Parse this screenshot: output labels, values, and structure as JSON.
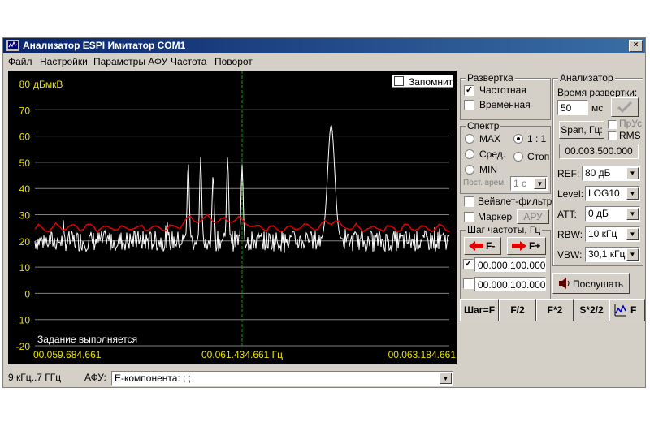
{
  "window": {
    "title": "Анализатор ESPI Имитатор COM1",
    "close": "×"
  },
  "menu": [
    "Файл",
    "Настройки",
    "Параметры АФУ",
    "Частота",
    "Поворот"
  ],
  "plot": {
    "unit": "дБмкВ",
    "y_ticks": [
      "80",
      "70",
      "60",
      "50",
      "40",
      "30",
      "20",
      "10",
      "0",
      "-10",
      "-20"
    ],
    "x_ticks": [
      "00.059.684.661",
      "00.061.434.661 Гц",
      "00.063.184.661"
    ],
    "status_text": "Задание выполняется",
    "memorize_label": "Запомнить",
    "colors": {
      "background": "#000000",
      "trace": "#ffffff",
      "average": "#e00000",
      "marker": "#00a000",
      "labels": "#e8e000",
      "grid": "#808080"
    }
  },
  "chart_data": {
    "type": "line",
    "ylabel": "дБмкВ",
    "ylim": [
      -20,
      80
    ],
    "xlim": [
      "00.059.684.661",
      "00.063.184.661"
    ],
    "peaks": [
      {
        "x": 0.37,
        "level": 50
      },
      {
        "x": 0.4,
        "level": 52
      },
      {
        "x": 0.43,
        "level": 45
      },
      {
        "x": 0.465,
        "level": 52
      },
      {
        "x": 0.5,
        "level": 49
      },
      {
        "x": 0.715,
        "level": 64
      }
    ],
    "noise_level": 20,
    "average_level": 25,
    "marker_x": 0.5
  },
  "status": {
    "range": "9 кГц..7 ГГц",
    "afu_label": "АФУ:",
    "afu_value": "E-компонента: ; ;"
  },
  "sweep": {
    "title": "Развертка",
    "freq": "Частотная",
    "freq_checked": true,
    "time": "Временная",
    "time_checked": false
  },
  "spectrum": {
    "title": "Спектр",
    "max": "MAX",
    "ratio": "1 : 1",
    "avg": "Сред.",
    "stop": "Стоп",
    "min": "MIN",
    "const_label": "Пост. врем.",
    "const_value": "1 с"
  },
  "wavelet": "Вейвлет-фильтр",
  "marker": {
    "label": "Маркер",
    "afu_btn": "АРУ"
  },
  "step": {
    "title": "Шаг частоты, Гц",
    "fminus": "F-",
    "fplus": "F+",
    "val1": "00.000.100.000",
    "val2": "00.000.100.000",
    "val1_checked": true,
    "val2_checked": false
  },
  "analyzer": {
    "title": "Анализатор",
    "sweep_time_label": "Время развертки:",
    "sweep_time_value": "50",
    "ms": "мс",
    "span_btn": "Span, Гц:",
    "pru": "ПрУс",
    "rms": "RMS",
    "span_value": "00.003.500.000",
    "ref_label": "REF:",
    "ref_value": "80 дБ",
    "level_label": "Level:",
    "level_value": "LOG10",
    "att_label": "ATT:",
    "att_value": "0 дБ",
    "rbw_label": "RBW:",
    "rbw_value": "10 кГц",
    "vbw_label": "VBW:",
    "vbw_value": "30,1 кГц",
    "listen_btn": "Послушать"
  },
  "bottom_buttons": [
    "Шаг=F",
    "F/2",
    "F*2",
    "S*2/2",
    "F"
  ]
}
